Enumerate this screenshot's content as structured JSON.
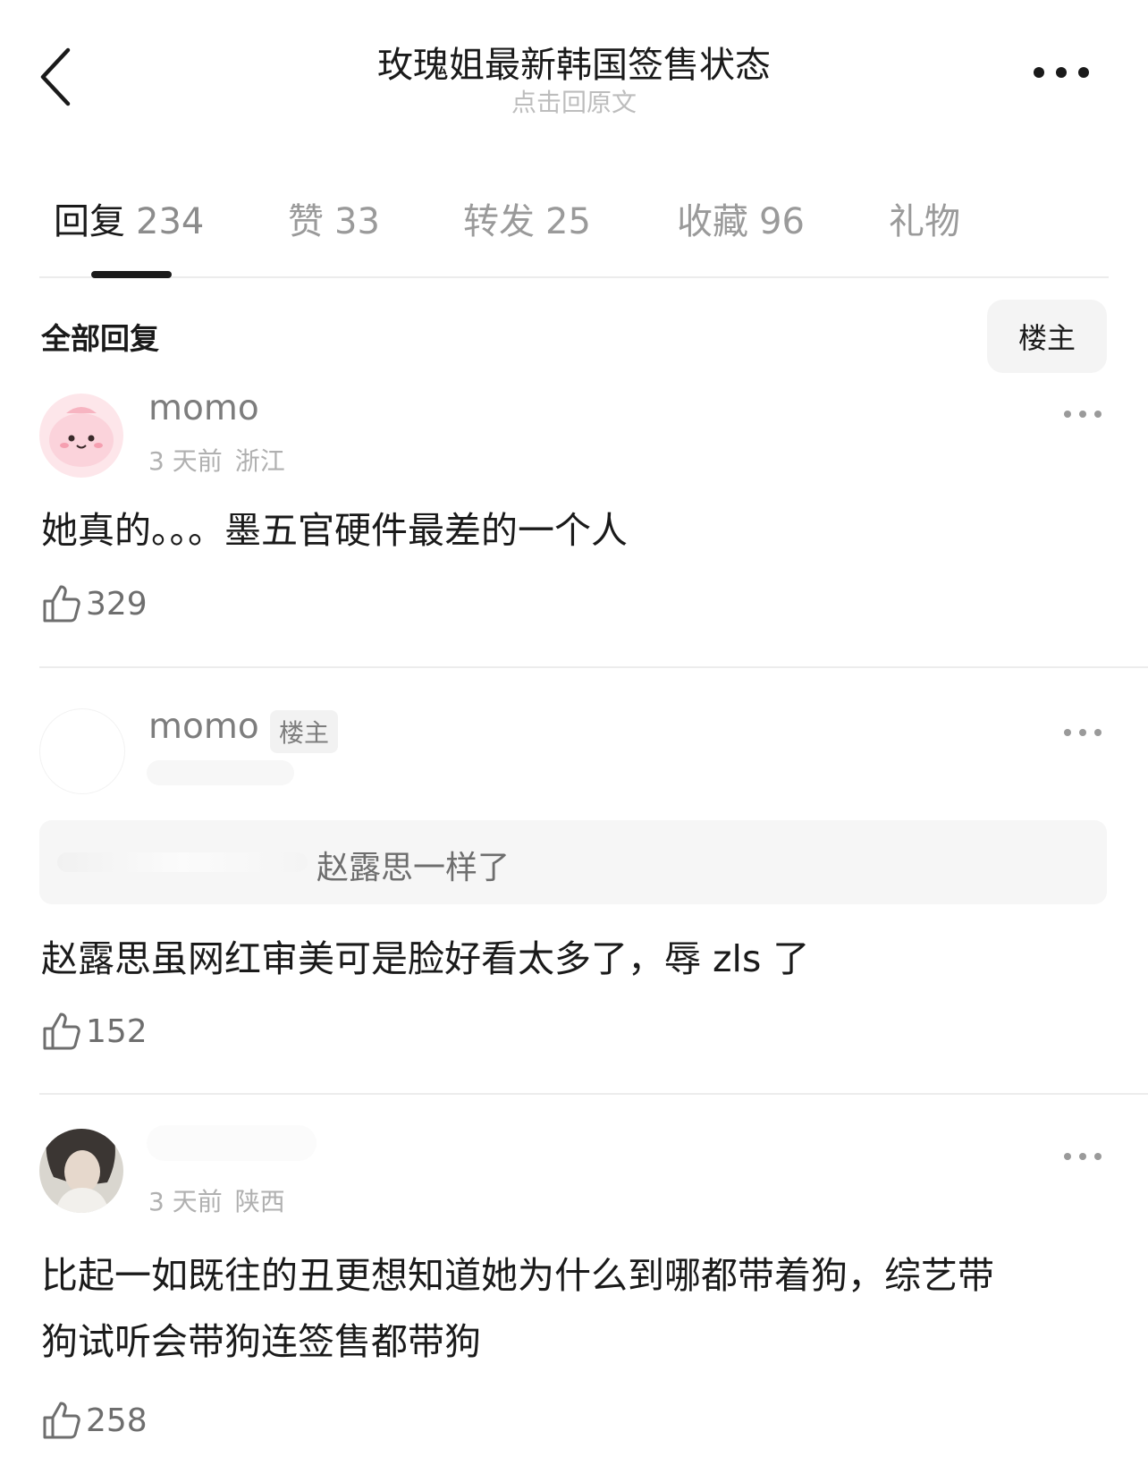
{
  "header": {
    "title": "玫瑰姐最新韩国签售状态",
    "subtitle": "点击回原文",
    "back_icon": "chevron-left-icon",
    "more_icon": "more-dots-icon"
  },
  "tabs": [
    {
      "label": "回复",
      "count": "234",
      "active": true
    },
    {
      "label": "赞",
      "count": "33"
    },
    {
      "label": "转发",
      "count": "25"
    },
    {
      "label": "收藏",
      "count": "96"
    },
    {
      "label": "礼物",
      "count": ""
    }
  ],
  "section": {
    "title": "全部回复",
    "filter_label": "楼主"
  },
  "comments": [
    {
      "username": "momo",
      "time": "3 天前",
      "location": "浙江",
      "text": "她真的。。。墨五官硬件最差的一个人",
      "likes": "329"
    },
    {
      "username": "momo",
      "badge": "楼主",
      "quote": "赵露思一样了",
      "text": "赵露思虽网红审美可是脸好看太多了，辱 zls 了",
      "likes": "152"
    },
    {
      "username": "",
      "time": "3 天前",
      "location": "陕西",
      "text_line1": "比起一如既往的丑更想知道她为什么到哪都带着狗，综艺带",
      "text_line2": "狗试听会带狗连签售都带狗",
      "likes": "258"
    }
  ],
  "colors": {
    "primary_text": "#1a1a1a",
    "secondary_text": "#7d7d7d",
    "muted_text": "#b0b0b0",
    "divider": "#ececec",
    "pill_bg": "#f4f4f4"
  }
}
